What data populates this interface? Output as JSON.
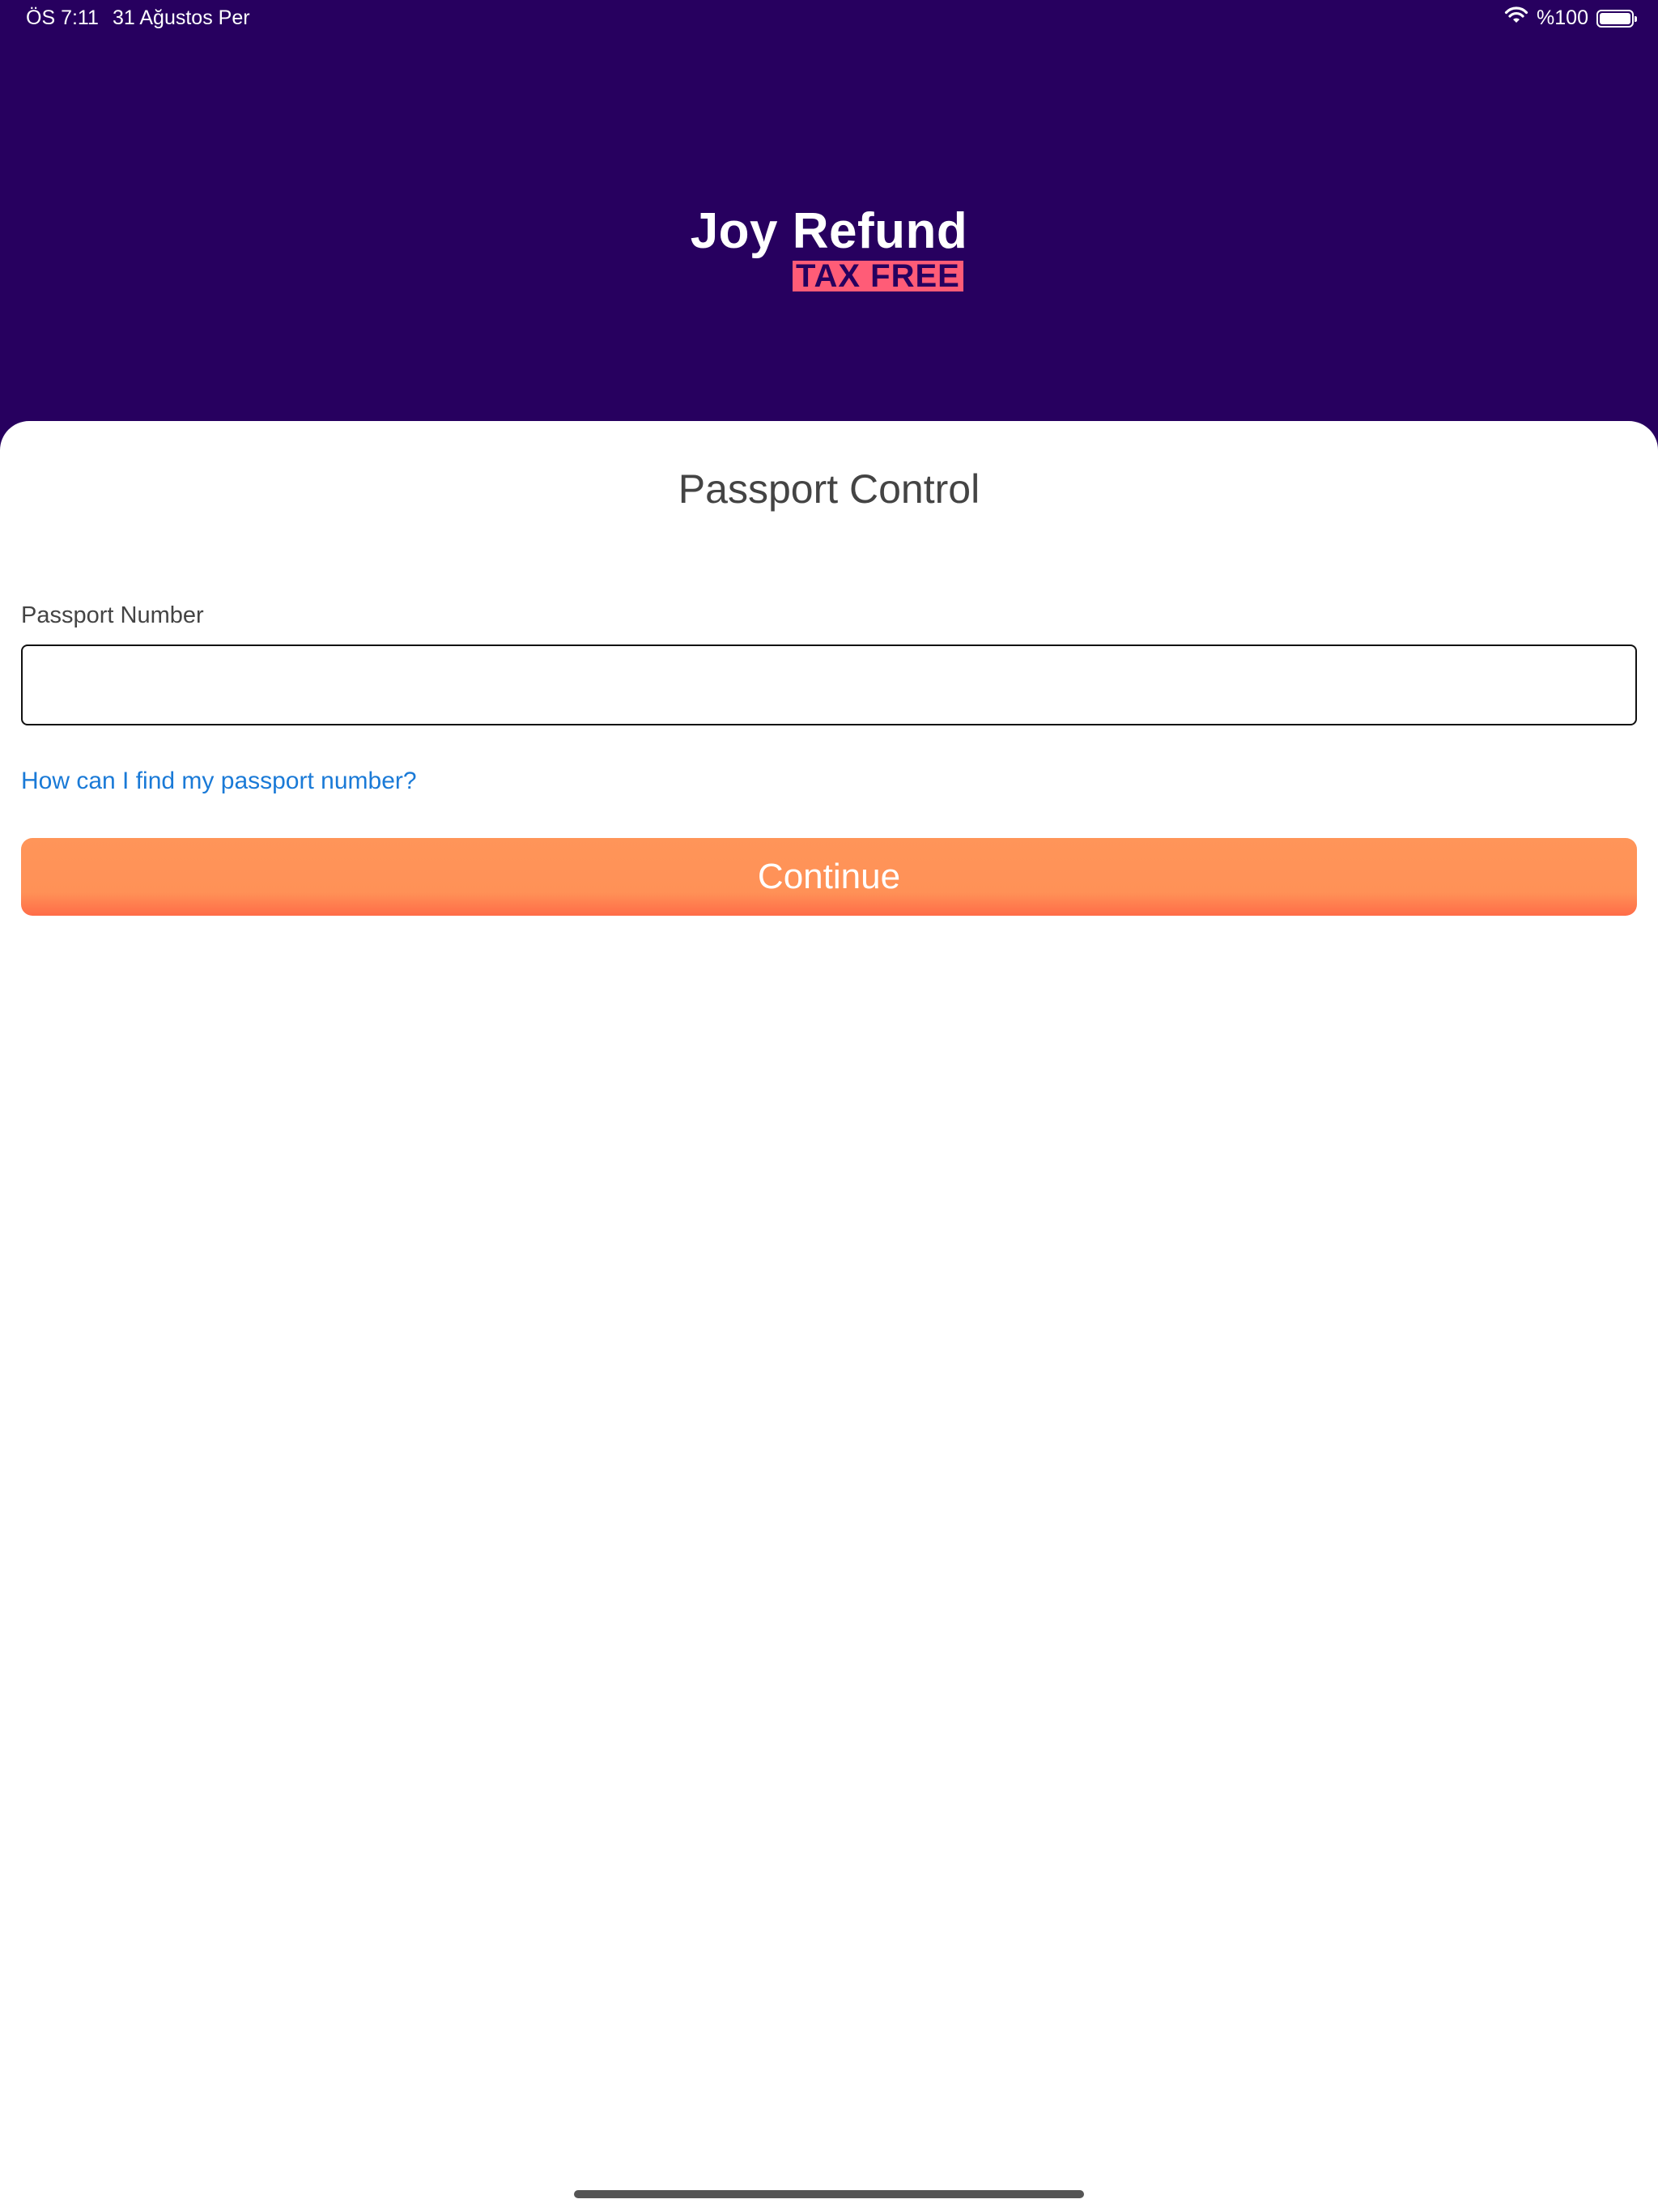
{
  "status_bar": {
    "time": "ÖS 7:11",
    "date": "31 Ağustos Per",
    "battery_text": "%100",
    "icons": [
      "wifi-icon",
      "battery-icon"
    ]
  },
  "header": {
    "logo_title": "Joy Refund",
    "logo_subtitle": "TAX FREE",
    "background_color": "#27005f",
    "accent_color": "#ff5c77"
  },
  "form": {
    "title": "Passport Control",
    "passport_label": "Passport Number",
    "passport_value": "",
    "passport_placeholder": "",
    "help_link": "How can I find my passport number?",
    "continue_label": "Continue",
    "button_color": "#ff9157",
    "link_color": "#1a7ad7"
  }
}
